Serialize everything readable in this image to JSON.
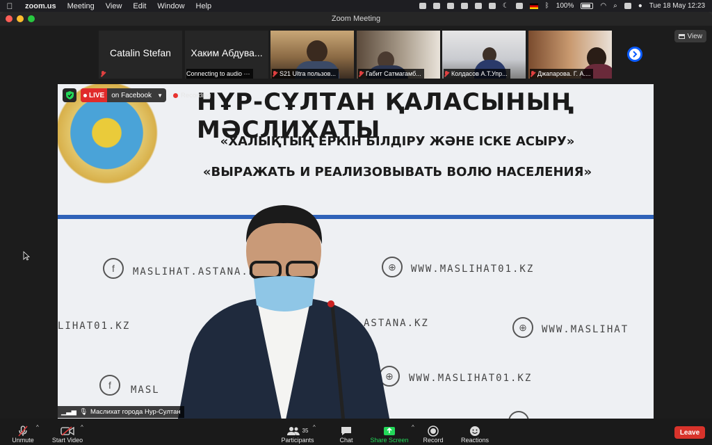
{
  "menubar": {
    "app_name": "zoom.us",
    "menus": [
      "Meeting",
      "View",
      "Edit",
      "Window",
      "Help"
    ],
    "battery": "100%",
    "datetime": "Tue 18 May  12:23"
  },
  "window": {
    "title": "Zoom Meeting"
  },
  "view_button": {
    "label": "View"
  },
  "participants_strip": [
    {
      "big_name": "Catalin Stefan",
      "label": ""
    },
    {
      "big_name": "Хаким Абдува...",
      "label": "Connecting to audio ···"
    },
    {
      "big_name": "",
      "label": "S21 Ultra пользов..."
    },
    {
      "big_name": "",
      "label": "Габит Сатмагамб..."
    },
    {
      "big_name": "",
      "label": "Колдасов А.Т.Упр..."
    },
    {
      "big_name": "",
      "label": "Джапарова. Г. А...."
    }
  ],
  "stream": {
    "live_tag": "LIVE",
    "live_target": "on Facebook",
    "recording": "Recording"
  },
  "slide": {
    "title": "НҰР-СҰЛТАН ҚАЛАСЫНЫҢ МӘСЛИХАТЫ",
    "slogan_kz": "«ХАЛЫҚТЫҢ ЕРКІН БІЛДІРУ ЖӘНЕ ІСКЕ АСЫРУ»",
    "slogan_ru": "«ВЫРАЖАТЬ И РЕАЛИЗОВЫВАТЬ ВОЛЮ НАСЕЛЕНИЯ»",
    "wm_1": "MASLIHAT.ASTANA.KZ",
    "wm_2": "WWW.MASLIHAT01.KZ",
    "wm_3": "LIHAT01.KZ",
    "wm_4": "ASTANA.KZ",
    "wm_5": "WWW.MASLIHAT",
    "wm_6": "WWW.MASLIHAT01.KZ",
    "wm_7": "MASL"
  },
  "active_speaker": {
    "name": "Маслихат города Нур-Султан"
  },
  "toolbar": {
    "unmute": "Unmute",
    "start_video": "Start Video",
    "participants": "Participants",
    "participants_count": "35",
    "chat": "Chat",
    "share_screen": "Share Screen",
    "record": "Record",
    "reactions": "Reactions",
    "leave": "Leave"
  },
  "colors": {
    "accent_green": "#23d959",
    "leave_red": "#d8332b",
    "live_red": "#e02b2b",
    "zoom_blue": "#0b5cff"
  }
}
